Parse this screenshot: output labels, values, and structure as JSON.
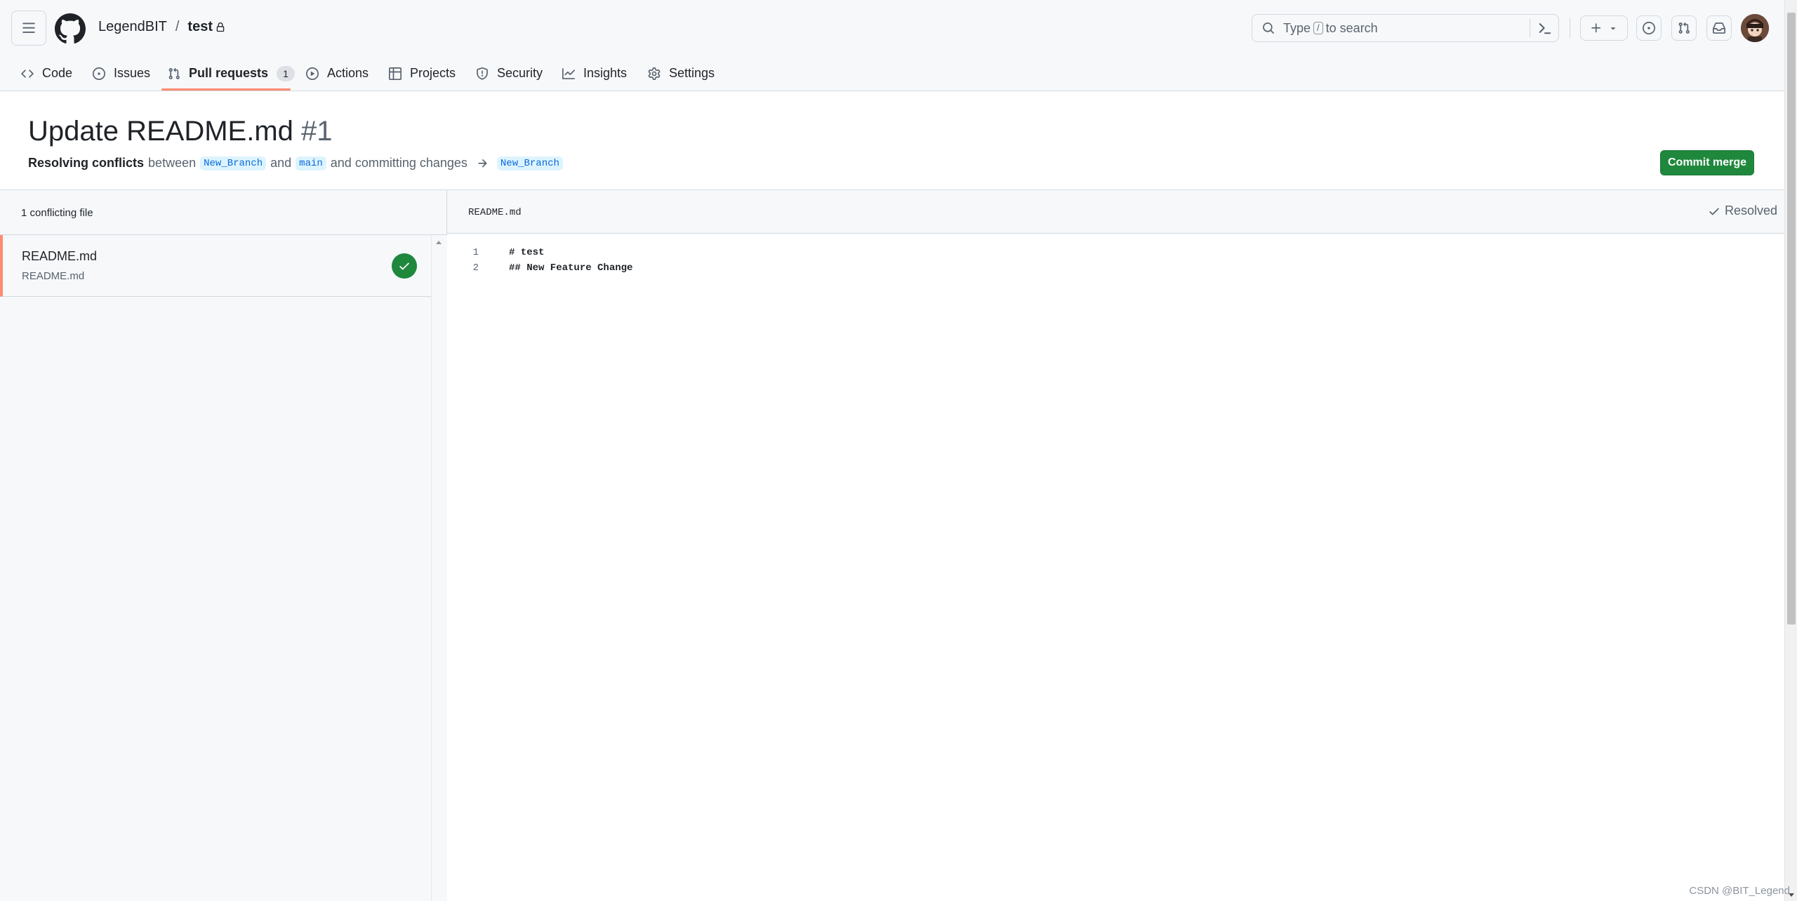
{
  "header": {
    "repo_owner": "LegendBIT",
    "repo_separator": "/",
    "repo_name": "test",
    "search_prefix": "Type",
    "search_key": "/",
    "search_suffix": "to search"
  },
  "tabs": [
    {
      "label": "Code",
      "icon": "code-icon"
    },
    {
      "label": "Issues",
      "icon": "issue-opened-icon"
    },
    {
      "label": "Pull requests",
      "icon": "git-pull-request-icon",
      "count": "1",
      "active": true
    },
    {
      "label": "Actions",
      "icon": "play-icon"
    },
    {
      "label": "Projects",
      "icon": "table-icon"
    },
    {
      "label": "Security",
      "icon": "shield-icon"
    },
    {
      "label": "Insights",
      "icon": "graph-icon"
    },
    {
      "label": "Settings",
      "icon": "gear-icon"
    }
  ],
  "pr": {
    "title": "Update README.md",
    "number": "#1",
    "subtitle_bold": "Resolving conflicts",
    "subtitle_between": "between",
    "branch_head": "New_Branch",
    "subtitle_and": "and",
    "branch_base": "main",
    "subtitle_tail": "and committing changes",
    "branch_target": "New_Branch",
    "commit_button": "Commit merge"
  },
  "files": {
    "count_label": "1 conflicting file",
    "items": [
      {
        "name": "README.md",
        "path": "README.md",
        "status": "resolved"
      }
    ]
  },
  "editor": {
    "filename": "README.md",
    "resolved_label": "Resolved",
    "lines": [
      {
        "number": "1",
        "text": "# test"
      },
      {
        "number": "2",
        "text": "## New Feature Change"
      }
    ]
  },
  "colors": {
    "accent_underline": "#fd8c73",
    "primary_button": "#1f883d",
    "branch_bg": "#ddf4ff",
    "branch_text": "#0969da"
  },
  "watermark": "CSDN @BIT_Legend"
}
